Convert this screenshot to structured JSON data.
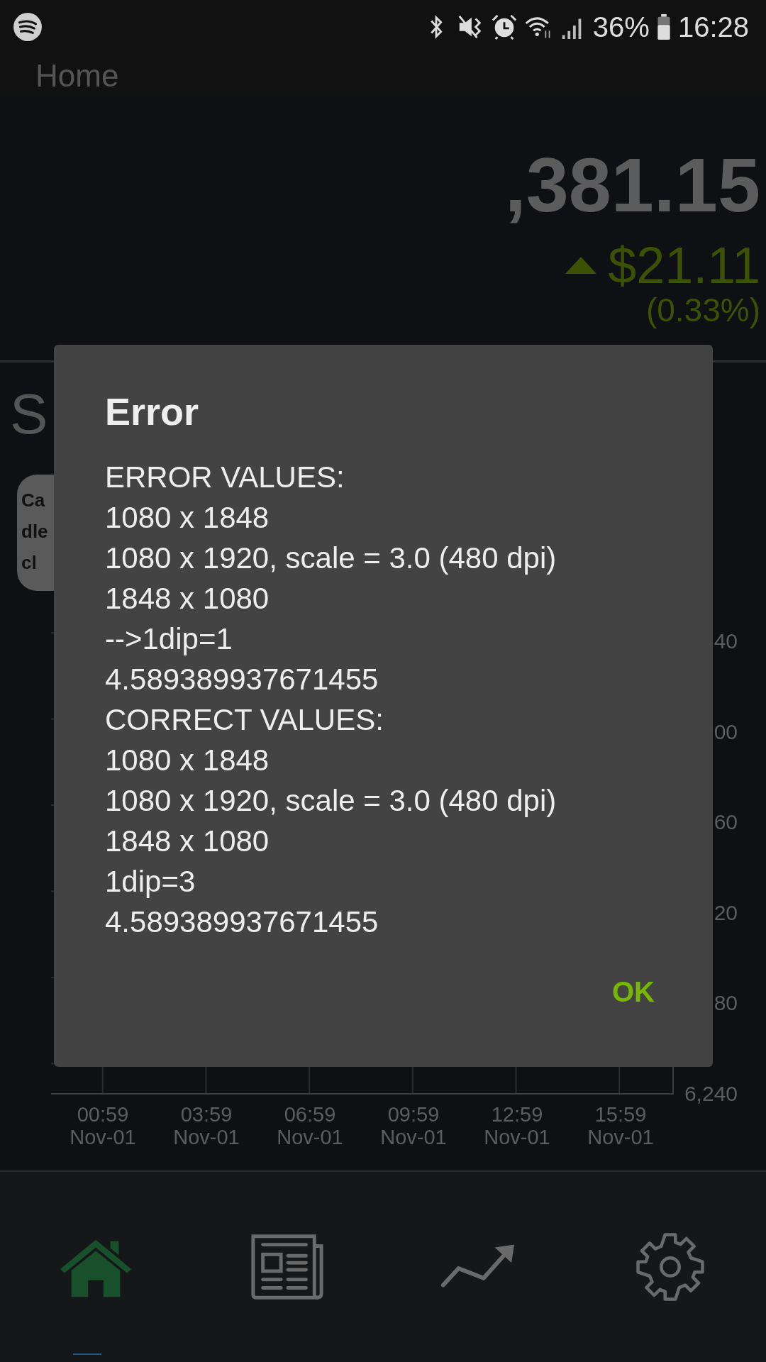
{
  "status_bar": {
    "battery": "36%",
    "time": "16:28"
  },
  "header": {
    "title": "Home"
  },
  "portfolio": {
    "value": ",381.15",
    "change": "$21.11",
    "percent": "(0.33%)"
  },
  "section": {
    "title": "S"
  },
  "chip": {
    "label": "Ca dle cl"
  },
  "chart": {
    "y_labels": [
      "40",
      "00",
      "60",
      "20",
      "80",
      "6,240"
    ],
    "x_labels": [
      {
        "time": "00:59",
        "date": "Nov-01"
      },
      {
        "time": "03:59",
        "date": "Nov-01"
      },
      {
        "time": "06:59",
        "date": "Nov-01"
      },
      {
        "time": "09:59",
        "date": "Nov-01"
      },
      {
        "time": "12:59",
        "date": "Nov-01"
      },
      {
        "time": "15:59",
        "date": "Nov-01"
      }
    ]
  },
  "dialog": {
    "title": "Error",
    "lines": [
      "ERROR VALUES:",
      "1080 x 1848",
      "1080 x 1920, scale = 3.0 (480 dpi)",
      "1848 x 1080",
      "-->1dip=1",
      "4.589389937671455",
      "CORRECT VALUES:",
      "1080 x 1848",
      "1080 x 1920, scale = 3.0 (480 dpi)",
      "1848 x 1080",
      "1dip=3",
      "4.589389937671455"
    ],
    "button": "OK"
  },
  "nav": [
    {
      "kind": "home",
      "selected": true
    },
    {
      "kind": "news",
      "selected": false
    },
    {
      "kind": "trend",
      "selected": false
    },
    {
      "kind": "settings",
      "selected": false
    }
  ]
}
